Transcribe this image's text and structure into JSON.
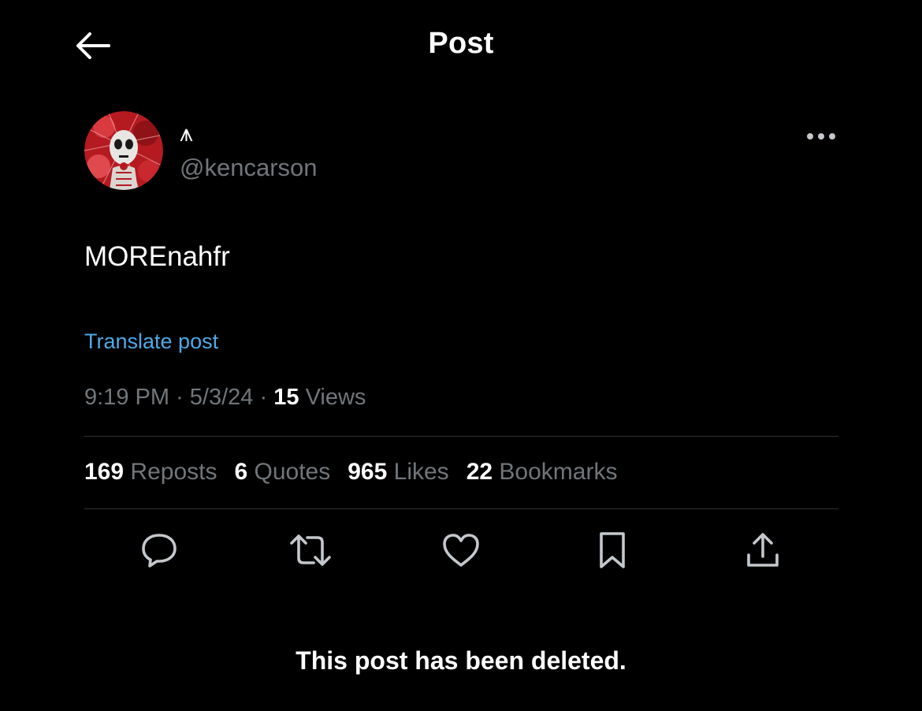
{
  "header": {
    "title": "Post",
    "back_icon": "arrow-left-icon"
  },
  "author": {
    "display_name": "⩚",
    "handle": "@kencarson",
    "avatar_colors": [
      "#c81e24",
      "#e8e6e3"
    ]
  },
  "post": {
    "text": "MOREnahfr",
    "translate_label": "Translate post",
    "time": "9:19 PM",
    "date": "5/3/24",
    "separator": "·",
    "views_count": "15",
    "views_label": "Views"
  },
  "stats": [
    {
      "count": "169",
      "label": "Reposts"
    },
    {
      "count": "6",
      "label": "Quotes"
    },
    {
      "count": "965",
      "label": "Likes"
    },
    {
      "count": "22",
      "label": "Bookmarks"
    }
  ],
  "actions": [
    {
      "name": "reply",
      "icon": "speech-bubble-icon"
    },
    {
      "name": "repost",
      "icon": "repost-arrows-icon"
    },
    {
      "name": "like",
      "icon": "heart-icon"
    },
    {
      "name": "bookmark",
      "icon": "bookmark-icon"
    },
    {
      "name": "share",
      "icon": "share-upload-icon"
    }
  ],
  "status_message": "This post has been deleted.",
  "colors": {
    "background": "#000000",
    "text_primary": "#ffffff",
    "text_secondary": "#71767b",
    "link": "#4fa9e6",
    "divider": "#2f3336",
    "icon": "#c4c8cc"
  }
}
